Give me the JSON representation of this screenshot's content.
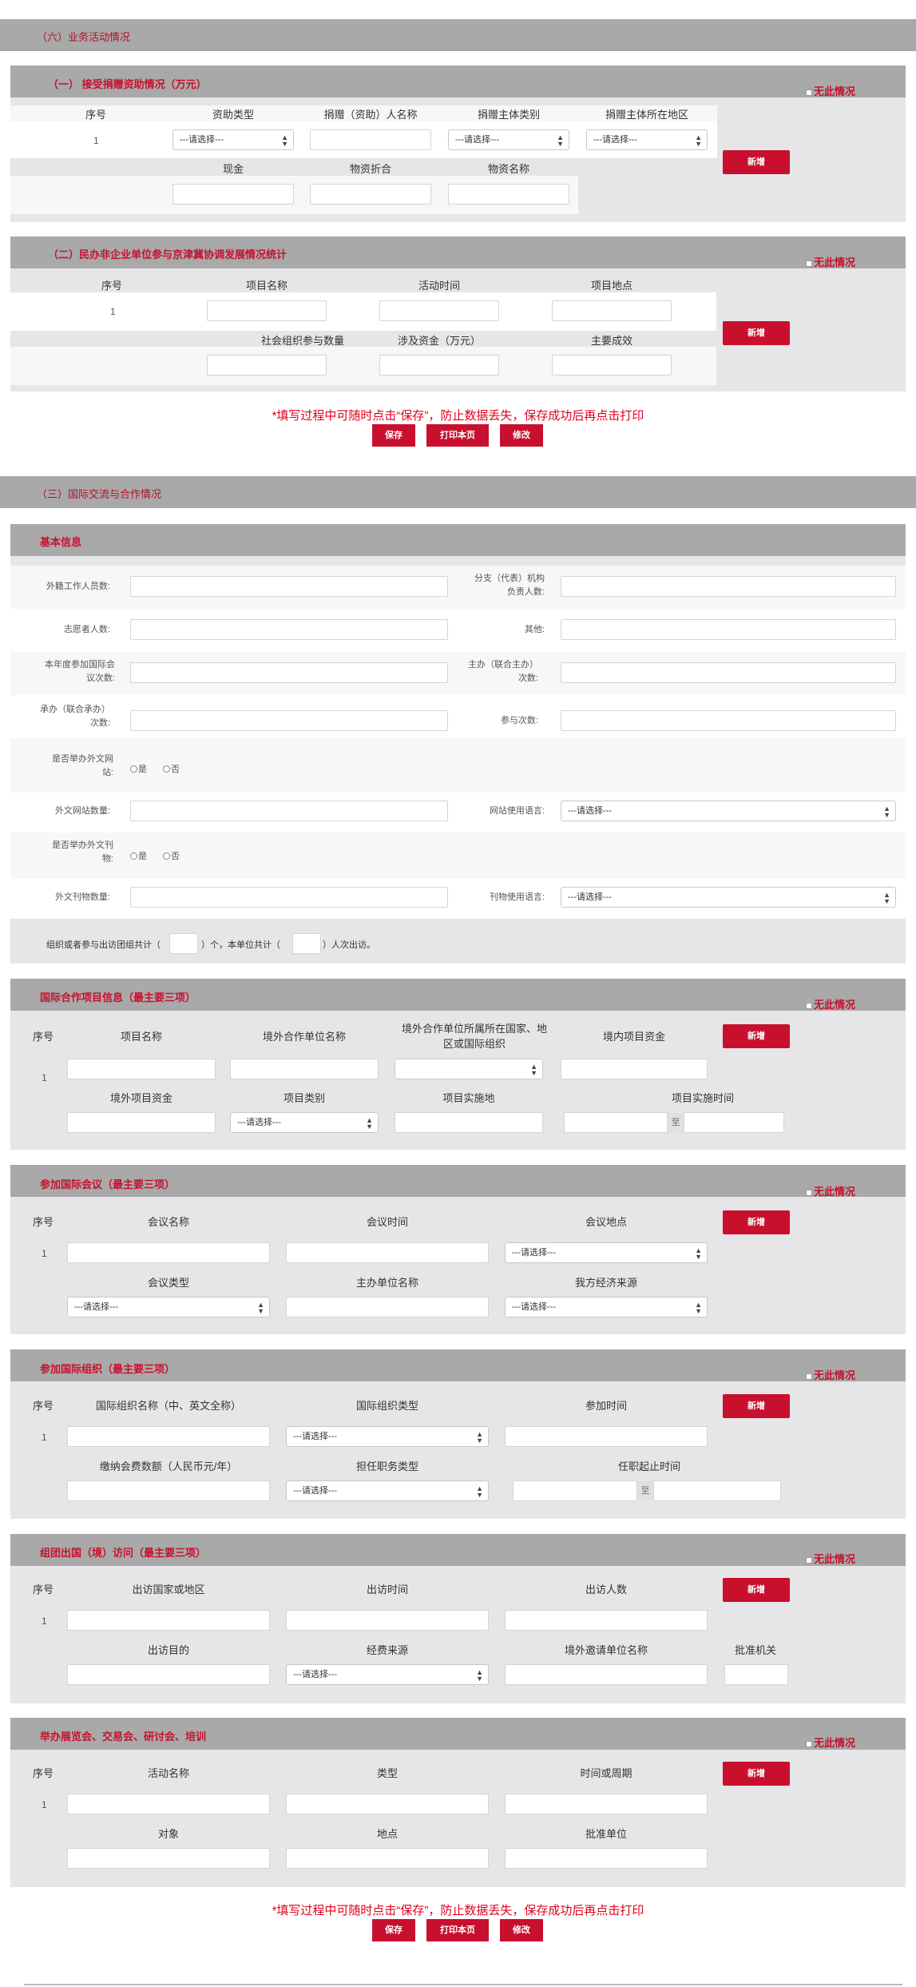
{
  "section6": {
    "title": "（六）业务活动情况"
  },
  "donation": {
    "title": "（一） 接受捐赠资助情况（万元）",
    "no_situation": "无此情况",
    "headers": [
      "序号",
      "资助类型",
      "捐赠（资助）人名称",
      "捐赠主体类别",
      "捐赠主体所在地区"
    ],
    "headers2": [
      "现金",
      "物资折合",
      "物资名称"
    ],
    "row_no": "1",
    "select_placeholder": "---请选择---",
    "add": "新增"
  },
  "beijing": {
    "title": "（二）民办非企业单位参与京津冀协调发展情况统计",
    "no_situation": "无此情况",
    "headers": [
      "序号",
      "项目名称",
      "活动时间",
      "项目地点"
    ],
    "headers2": [
      "社会组织参与数量",
      "涉及资金（万元）",
      "主要成效"
    ],
    "row_no": "1",
    "add": "新增"
  },
  "actions1": {
    "warning": "*填写过程中可随时点击“保存”，防止数据丢失，保存成功后再点击打印",
    "save": "保存",
    "print": "打印本页",
    "modify": "修改"
  },
  "section3": {
    "title": "（三）国际交流与合作情况"
  },
  "basic": {
    "title": "基本信息",
    "foreign_staff": "外籍工作人员数:",
    "branch_head_1": "分支（代表）机构",
    "branch_head_2": "负责人数:",
    "volunteers": "志愿者人数:",
    "other": "其他:",
    "conf_1": "本年度参加国际会",
    "conf_2": "议次数:",
    "host_1": "主办（联合主办）",
    "host_2": "次数:",
    "undertake_1": "承办（联合承办）",
    "undertake_2": "次数:",
    "participate": "参与次数:",
    "site_q_1": "是否举办外文网",
    "site_q_2": "站:",
    "yes": "是",
    "no": "否",
    "site_count": "外文网站数量:",
    "site_lang": "网站使用语言:",
    "pub_q_1": "是否举办外文刊",
    "pub_q_2": "物:",
    "pub_count": "外文刊物数量:",
    "pub_lang": "刊物使用语言:",
    "select_placeholder": "---请选择---",
    "visit_text_1": "组织或者参与出访团组共计（",
    "visit_text_2": "）个，本单位共计（",
    "visit_text_3": "）人次出访。"
  },
  "intl_projects": {
    "title": "国际合作项目信息（最主要三项）",
    "no_situation": "无此情况",
    "headers": [
      "序号",
      "项目名称",
      "境外合作单位名称",
      "境外合作单位所属所在国家、地",
      "区或国际组织",
      "境内项目资金"
    ],
    "headers2": [
      "境外项目资金",
      "项目类别",
      "项目实施地",
      "项目实施时间"
    ],
    "row_no": "1",
    "to": "至",
    "add": "新增"
  },
  "intl_conf": {
    "title": "参加国际会议（最主要三项）",
    "no_situation": "无此情况",
    "headers": [
      "序号",
      "会议名称",
      "会议时间",
      "会议地点"
    ],
    "headers2": [
      "会议类型",
      "主办单位名称",
      "我方经济来源"
    ],
    "row_no": "1",
    "add": "新增"
  },
  "intl_org": {
    "title": "参加国际组织（最主要三项）",
    "no_situation": "无此情况",
    "headers": [
      "序号",
      "国际组织名称（中、英文全称）",
      "国际组织类型",
      "参加时间"
    ],
    "headers2": [
      "缴纳会费数额（人民币元/年）",
      "担任职务类型",
      "任职起止时间"
    ],
    "row_no": "1",
    "to": "至",
    "add": "新增"
  },
  "visits": {
    "title": "组团出国（境）访问（最主要三项）",
    "no_situation": "无此情况",
    "headers": [
      "序号",
      "出访国家或地区",
      "出访时间",
      "出访人数"
    ],
    "headers2": [
      "出访目的",
      "经费来源",
      "境外邀请单位名称",
      "批准机关"
    ],
    "row_no": "1",
    "add": "新增"
  },
  "exhibit": {
    "title": "举办展览会、交易会、研讨会、培训",
    "no_situation": "无此情况",
    "headers": [
      "序号",
      "活动名称",
      "类型",
      "时间或周期"
    ],
    "headers2": [
      "对象",
      "地点",
      "批准单位"
    ],
    "row_no": "1",
    "add": "新增"
  },
  "actions2": {
    "warning": "*填写过程中可随时点击“保存”，防止数据丢失，保存成功后再点击打印",
    "save": "保存",
    "print": "打印本页",
    "modify": "修改"
  }
}
